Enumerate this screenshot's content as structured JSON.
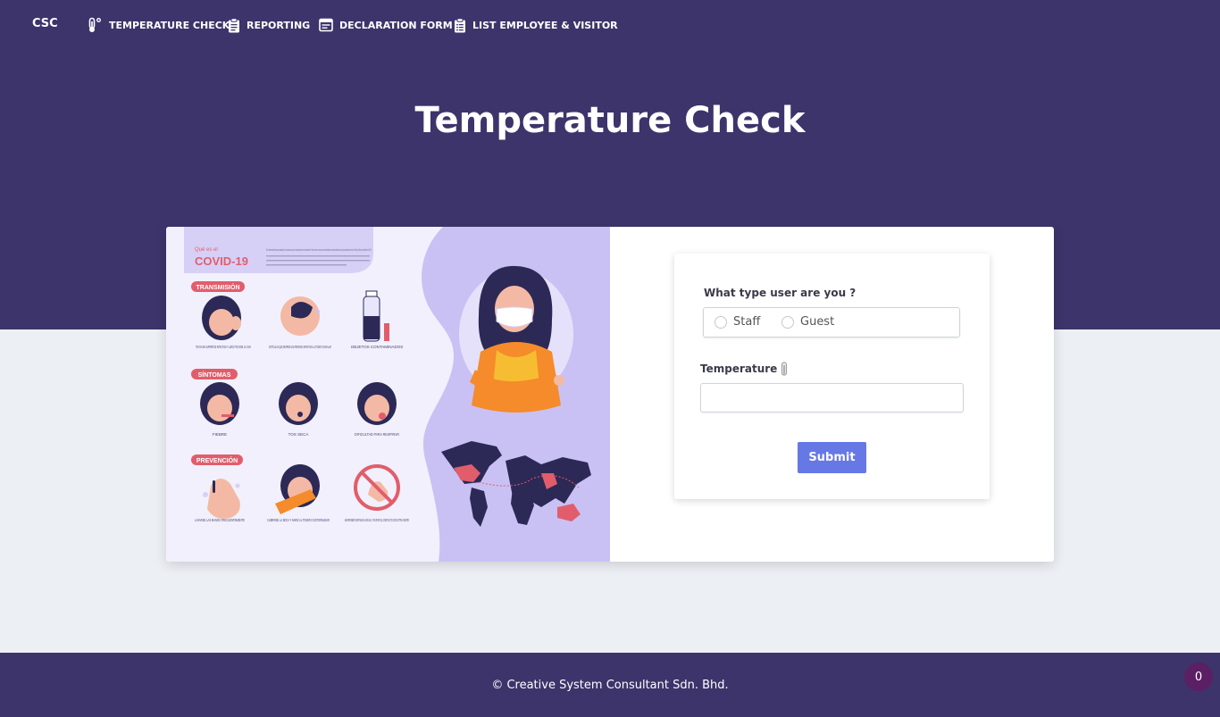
{
  "brand": "CSC",
  "nav": [
    {
      "label": "TEMPERATURE CHECK",
      "icon": "thermometer-icon"
    },
    {
      "label": "REPORTING",
      "icon": "clipboard-icon"
    },
    {
      "label": "DECLARATION FORM",
      "icon": "form-icon"
    },
    {
      "label": "LIST EMPLOYEE & VISITOR",
      "icon": "clipboard-list-icon"
    }
  ],
  "page_title": "Temperature Check",
  "illustration": {
    "heading_small": "Qué es el",
    "heading": "COVID-19",
    "intro": "Es la enfermedad infecciosa causada por el coronavirus que se ha descubierto más recientemente. Tanto el nuevo virus como la enfermedad eran desconocidos antes de que estallara el brote en Wuhan (China) en diciembre de 2019.",
    "sections": [
      {
        "title": "TRANSMISIÓN",
        "items": [
          "TOCAR UNA SUPERFICIE INFECTADA Y LUEGO TOCARSE LA CARA",
          "GOTÍCULAS QUE DESPIDE UNA PERSONA INFECTADA AL TOSER O EXHALAR",
          "OBJETOS CONTAMINADOS"
        ]
      },
      {
        "title": "SÍNTOMAS",
        "items": [
          "FIEBRE",
          "TOS SECA",
          "DIFICULTAD PARA RESPIRAR"
        ]
      },
      {
        "title": "PREVENCIÓN",
        "items": [
          "LAVARSE LAS MANOS FRECUENTEMENTE",
          "CUBRIRSE LA BOCA Y NARIZ AL TOSER O ESTORNUDAR",
          "MANTENER DISTANCIA SOCIAL Y EVITAR EL CONTACTO CON OTRA GENTE"
        ]
      }
    ]
  },
  "form": {
    "user_type_label": "What type user are you ?",
    "options": [
      "Staff",
      "Guest"
    ],
    "temperature_label": "Temperature",
    "temperature_value": "",
    "submit_label": "Submit"
  },
  "footer": "© Creative System Consultant Sdn. Bhd.",
  "badge_count": "0",
  "colors": {
    "hero_bg": "#3d346b",
    "page_bg": "#ecf0f5",
    "submit": "#6678e6",
    "badge": "#5b1f63",
    "illus_purple": "#c9c1f4",
    "illus_red": "#e25d6b"
  }
}
